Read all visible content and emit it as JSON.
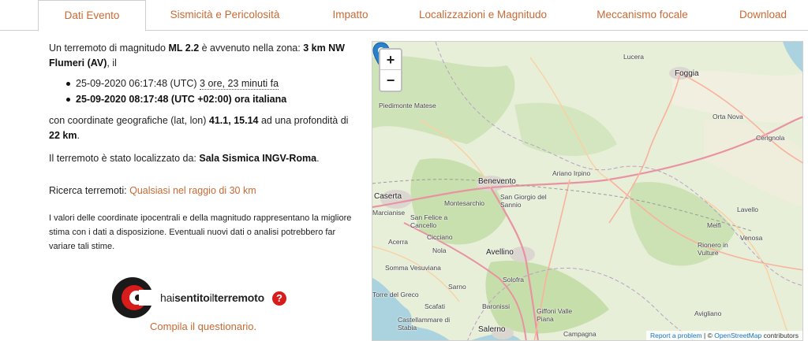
{
  "tabs": [
    {
      "label": "Dati Evento",
      "active": true
    },
    {
      "label": "Sismicità e Pericolosità"
    },
    {
      "label": "Impatto"
    },
    {
      "label": "Localizzazioni e Magnitudo"
    },
    {
      "label": "Meccanismo focale"
    },
    {
      "label": "Download"
    }
  ],
  "summary": {
    "prefix": "Un terremoto di magnitudo ",
    "magnitude": "ML 2.2",
    "mid": " è avvenuto nella zona: ",
    "zone": "3 km NW Flumeri (AV)",
    "suffix": ", il"
  },
  "times": {
    "utc": "25-09-2020 06:17:48 (UTC)",
    "ago": "3 ore, 23 minuti fa",
    "local": "25-09-2020 08:17:48 (UTC +02:00) ora italiana"
  },
  "coords": {
    "prefix": "con coordinate geografiche (lat, lon) ",
    "lat": "41.1",
    "sep": ", ",
    "lon": "15.14",
    "mid": " ad una profondità di ",
    "depth": "22 km",
    "end": "."
  },
  "located": {
    "prefix": "Il terremoto è stato localizzato da: ",
    "by": "Sala Sismica INGV-Roma",
    "end": "."
  },
  "search": {
    "prefix": "Ricerca terremoti: ",
    "link": "Qualsiasi nel raggio di 30 km"
  },
  "note": "I valori delle coordinate ipocentrali e della magnitudo rappresentano la migliore stima con i dati a disposizione. Eventuali nuovi dati o analisi potrebbero far variare tali stime.",
  "hst": {
    "text_a": "hai",
    "text_b": "sentito",
    "text_c": "il",
    "text_d": "terremoto",
    "q": "?",
    "link": "Compila il questionario."
  },
  "map": {
    "zoom_in": "+",
    "zoom_out": "−",
    "places": [
      "Lucera",
      "Foggia",
      "Piedimonte Matese",
      "Orta Nova",
      "Cerignola",
      "Benevento",
      "Ariano Irpino",
      "San Giorgio del Sannio",
      "Caserta",
      "Montesarchio",
      "Lavello",
      "Marcianise",
      "San Felice a Cancello",
      "Cicciano",
      "Acerra",
      "Nola",
      "Avellino",
      "Melfi",
      "Venosa",
      "Rionero in Vulture",
      "Somma Vesuviana",
      "Solofra",
      "Torre del Greco",
      "Sarno",
      "Scafati",
      "Baronissi",
      "Giffoni Valle Piana",
      "Castellammare di Stabia",
      "Salerno",
      "Campagna",
      "Avigliano"
    ],
    "attr_link": "Report a problem",
    "attr_sep": " | © ",
    "attr_osm": "OpenStreetMap",
    "attr_end": " contributors"
  },
  "colors": {
    "accent": "#c86a34",
    "marker": "#2a81cb",
    "hst_red": "#d81b1b"
  }
}
